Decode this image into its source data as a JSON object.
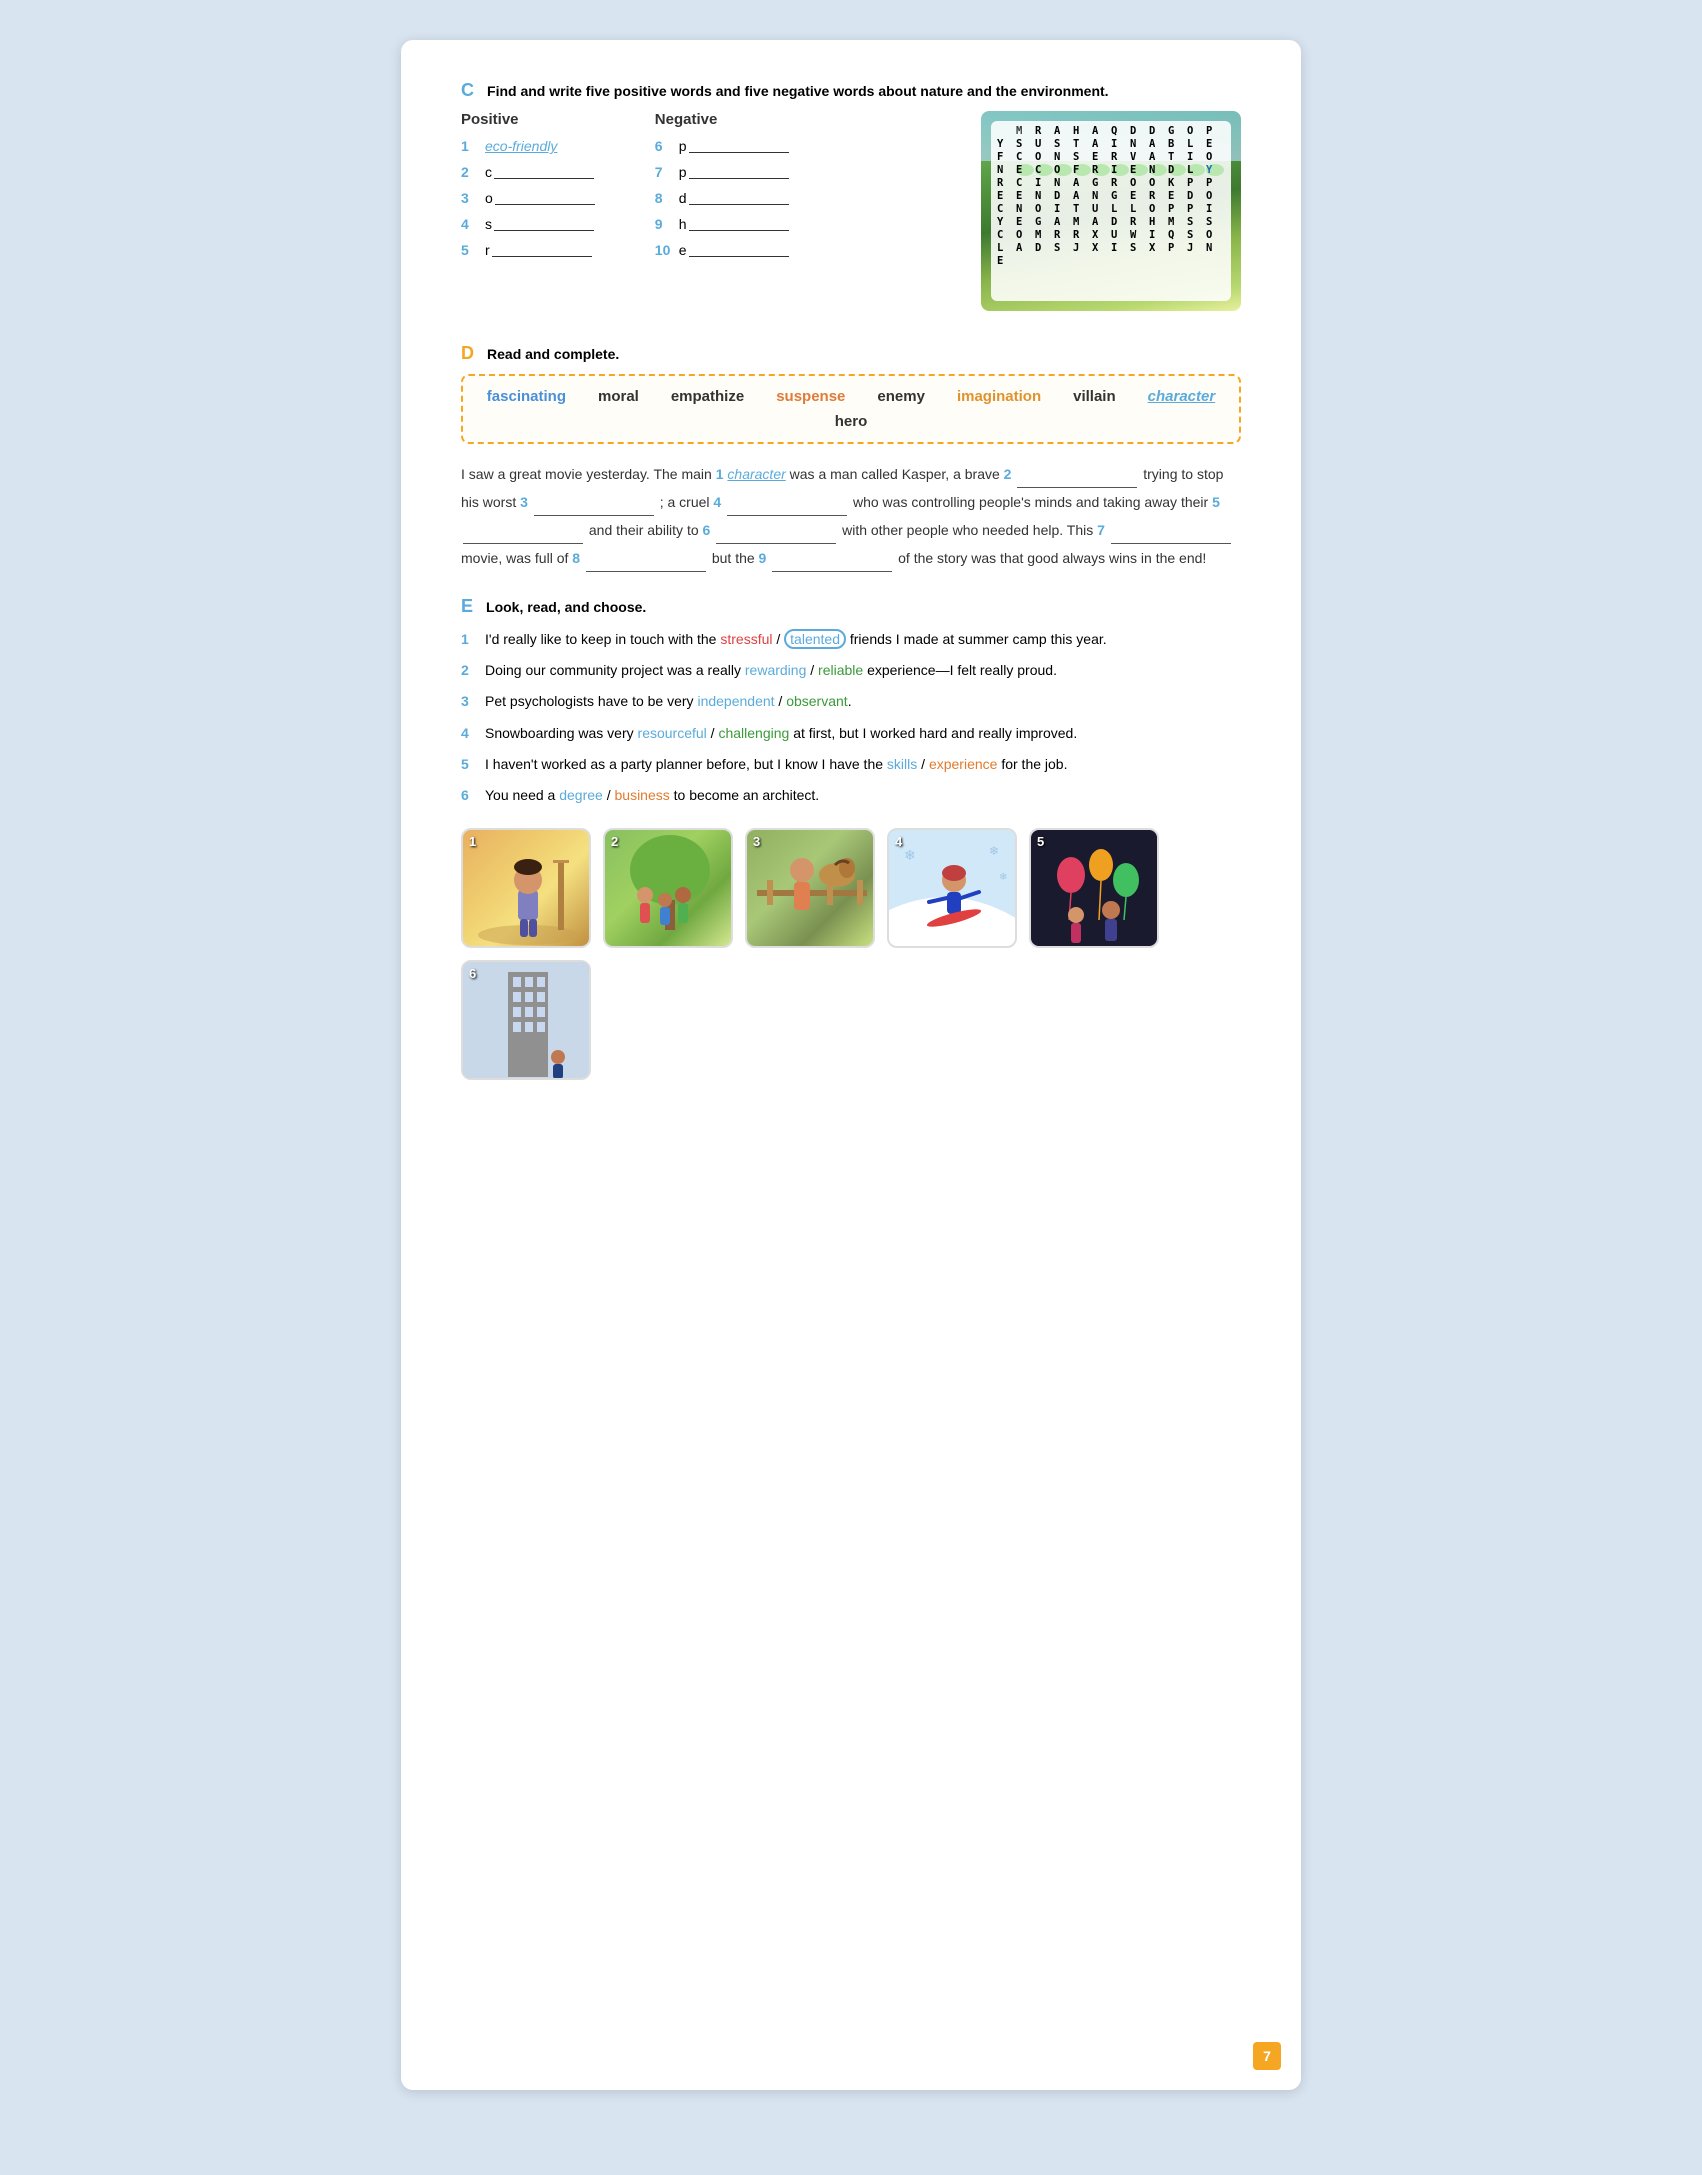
{
  "page": {
    "number": "7"
  },
  "sectionC": {
    "letter": "C",
    "instruction": "Find and write five positive words and five negative words about nature and the environment.",
    "positive_label": "Positive",
    "negative_label": "Negative",
    "positive_items": [
      {
        "num": "1",
        "text": "eco-friendly",
        "filled": true
      },
      {
        "num": "2",
        "letter": "c",
        "blank": true
      },
      {
        "num": "3",
        "letter": "o",
        "blank": true
      },
      {
        "num": "4",
        "letter": "s",
        "blank": true
      },
      {
        "num": "5",
        "letter": "r",
        "blank": true
      }
    ],
    "negative_items": [
      {
        "num": "6",
        "letter": "p",
        "blank": true
      },
      {
        "num": "7",
        "letter": "p",
        "blank": true
      },
      {
        "num": "8",
        "letter": "d",
        "blank": true
      },
      {
        "num": "9",
        "letter": "h",
        "blank": true
      },
      {
        "num": "10",
        "letter": "e",
        "blank": true
      }
    ],
    "wordsearch": {
      "rows": [
        [
          "M",
          "R",
          "A",
          "H",
          "A",
          "Q",
          "D",
          "D",
          "G",
          "O",
          "P",
          "Y"
        ],
        [
          "S",
          "U",
          "S",
          "T",
          "A",
          "I",
          "N",
          "A",
          "B",
          "L",
          "E",
          "F"
        ],
        [
          "C",
          "O",
          "N",
          "S",
          "E",
          "R",
          "V",
          "A",
          "T",
          "I",
          "O",
          "N"
        ],
        [
          "E",
          "C",
          "O",
          "F",
          "R",
          "I",
          "E",
          "N",
          "D",
          "L",
          "Y",
          "R"
        ],
        [
          "C",
          "I",
          "N",
          "A",
          "G",
          "R",
          "O",
          "O",
          "K",
          "P",
          "P",
          "E"
        ],
        [
          "E",
          "N",
          "D",
          "A",
          "N",
          "G",
          "E",
          "R",
          "E",
          "D",
          "O",
          "C"
        ],
        [
          "N",
          "O",
          "I",
          "T",
          "U",
          "L",
          "L",
          "O",
          "P",
          "P",
          "I",
          "Y"
        ],
        [
          "E",
          "G",
          "A",
          "M",
          "A",
          "D",
          "R",
          "H",
          "M",
          "S",
          "S",
          "C"
        ],
        [
          "O",
          "M",
          "R",
          "R",
          "X",
          "U",
          "W",
          "I",
          "Q",
          "S",
          "O",
          "L"
        ],
        [
          "A",
          "D",
          "S",
          "J",
          "X",
          "I",
          "S",
          "X",
          "P",
          "J",
          "N",
          "E"
        ]
      ]
    }
  },
  "sectionD": {
    "letter": "D",
    "instruction": "Read and complete.",
    "word_bank": [
      {
        "word": "fascinating",
        "class": "wb-fascinating"
      },
      {
        "word": "moral",
        "class": "wb-moral"
      },
      {
        "word": "empathize",
        "class": "wb-empathize"
      },
      {
        "word": "suspense",
        "class": "wb-suspense"
      },
      {
        "word": "enemy",
        "class": "wb-enemy"
      },
      {
        "word": "imagination",
        "class": "wb-imagination"
      },
      {
        "word": "villain",
        "class": "wb-villain"
      },
      {
        "word": "character",
        "class": "wb-character"
      },
      {
        "word": "hero",
        "class": "wb-hero"
      }
    ],
    "text_parts": [
      "I saw a great movie yesterday. The main ",
      "1",
      " character",
      " was a man called Kasper, a brave ",
      "2",
      " trying to stop his worst ",
      "3",
      " ; a cruel ",
      "4",
      " who was controlling people's minds and taking away their ",
      "5",
      " and their ability to ",
      "6",
      " with other people who needed help. This ",
      "7",
      " movie, was full of ",
      "8",
      " but the ",
      "9",
      " of the story was that good always wins in the end!"
    ]
  },
  "sectionE": {
    "letter": "E",
    "instruction": "Look, read, and choose.",
    "items": [
      {
        "num": "1",
        "before": "I'd really like to keep in touch with the",
        "opt1": "stressful",
        "slash": "/",
        "opt2": "talented",
        "opt2_circled": true,
        "after": "friends I made at summer camp this year.",
        "opt1_color": "red",
        "opt2_color": "blue"
      },
      {
        "num": "2",
        "before": "Doing our community project was a really",
        "opt1": "rewarding",
        "slash": "/",
        "opt2": "reliable",
        "after": "experience—I felt really proud.",
        "opt1_color": "blue",
        "opt2_color": "green"
      },
      {
        "num": "3",
        "before": "Pet psychologists have to be very",
        "opt1": "independent",
        "slash": "/",
        "opt2": "observant",
        "after": ".",
        "opt1_color": "blue",
        "opt2_color": "green"
      },
      {
        "num": "4",
        "before": "Snowboarding was very",
        "opt1": "resourceful",
        "slash": "/",
        "opt2": "challenging",
        "after": "at first, but I worked hard and really improved.",
        "opt1_color": "blue",
        "opt2_color": "green"
      },
      {
        "num": "5",
        "before": "I haven't worked as a party planner before, but I know I have the",
        "opt1": "skills",
        "slash": "/",
        "opt2": "experience",
        "after": "for the job.",
        "opt1_color": "blue",
        "opt2_color": "orange"
      },
      {
        "num": "6",
        "before": "You need a",
        "opt1": "degree",
        "slash": "/",
        "opt2": "business",
        "after": "to become an architect.",
        "opt1_color": "blue",
        "opt2_color": "orange"
      }
    ],
    "images": [
      {
        "num": "1",
        "class": "img-1"
      },
      {
        "num": "2",
        "class": "img-2"
      },
      {
        "num": "3",
        "class": "img-3"
      },
      {
        "num": "4",
        "class": "img-4"
      },
      {
        "num": "5",
        "class": "img-5"
      },
      {
        "num": "6",
        "class": "img-6"
      }
    ]
  }
}
